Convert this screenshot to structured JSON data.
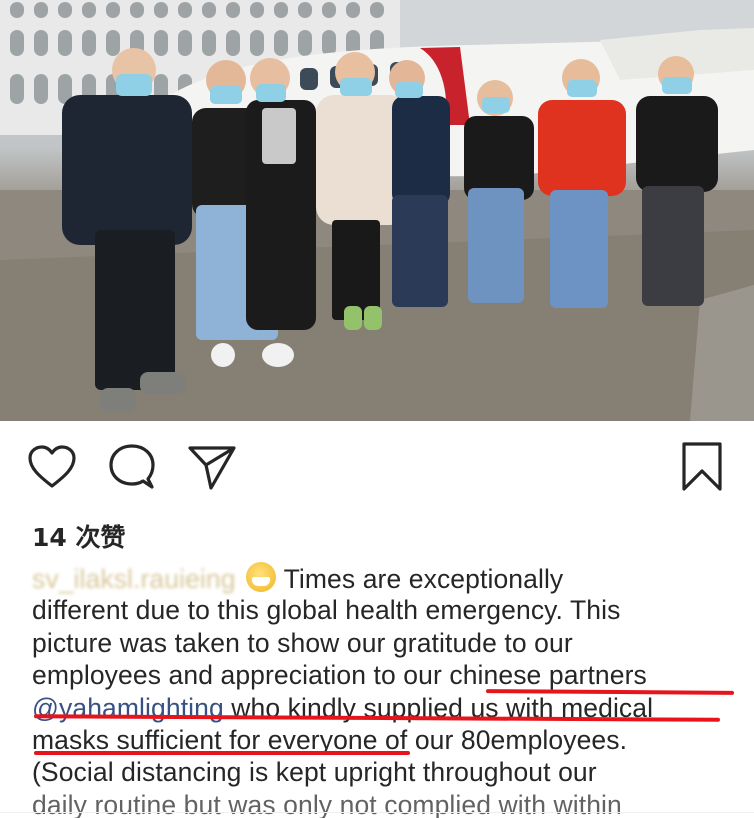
{
  "post": {
    "likes_label": "14 次赞",
    "username": "sv_ilaksl.rauieing",
    "caption_lines": [
      "Times are exceptionally",
      "different due to this global health emergency. This",
      "picture was taken to show our gratitude to our",
      "employees and appreciation to our ",
      "chinese partners",
      "@yahamlighting",
      " who kindly supplied us with medical",
      "masks sufficient for everyone",
      " of our 80employees.",
      "(Social distancing is kept upright throughout our",
      "daily routine but was only not complied with within"
    ]
  },
  "icons": {
    "like": "heart-icon",
    "comment": "speech-bubble-icon",
    "share": "paper-plane-icon",
    "save": "bookmark-icon"
  },
  "colors": {
    "text": "#262626",
    "mention": "#385185",
    "annotation_underline": "#e8141b"
  }
}
